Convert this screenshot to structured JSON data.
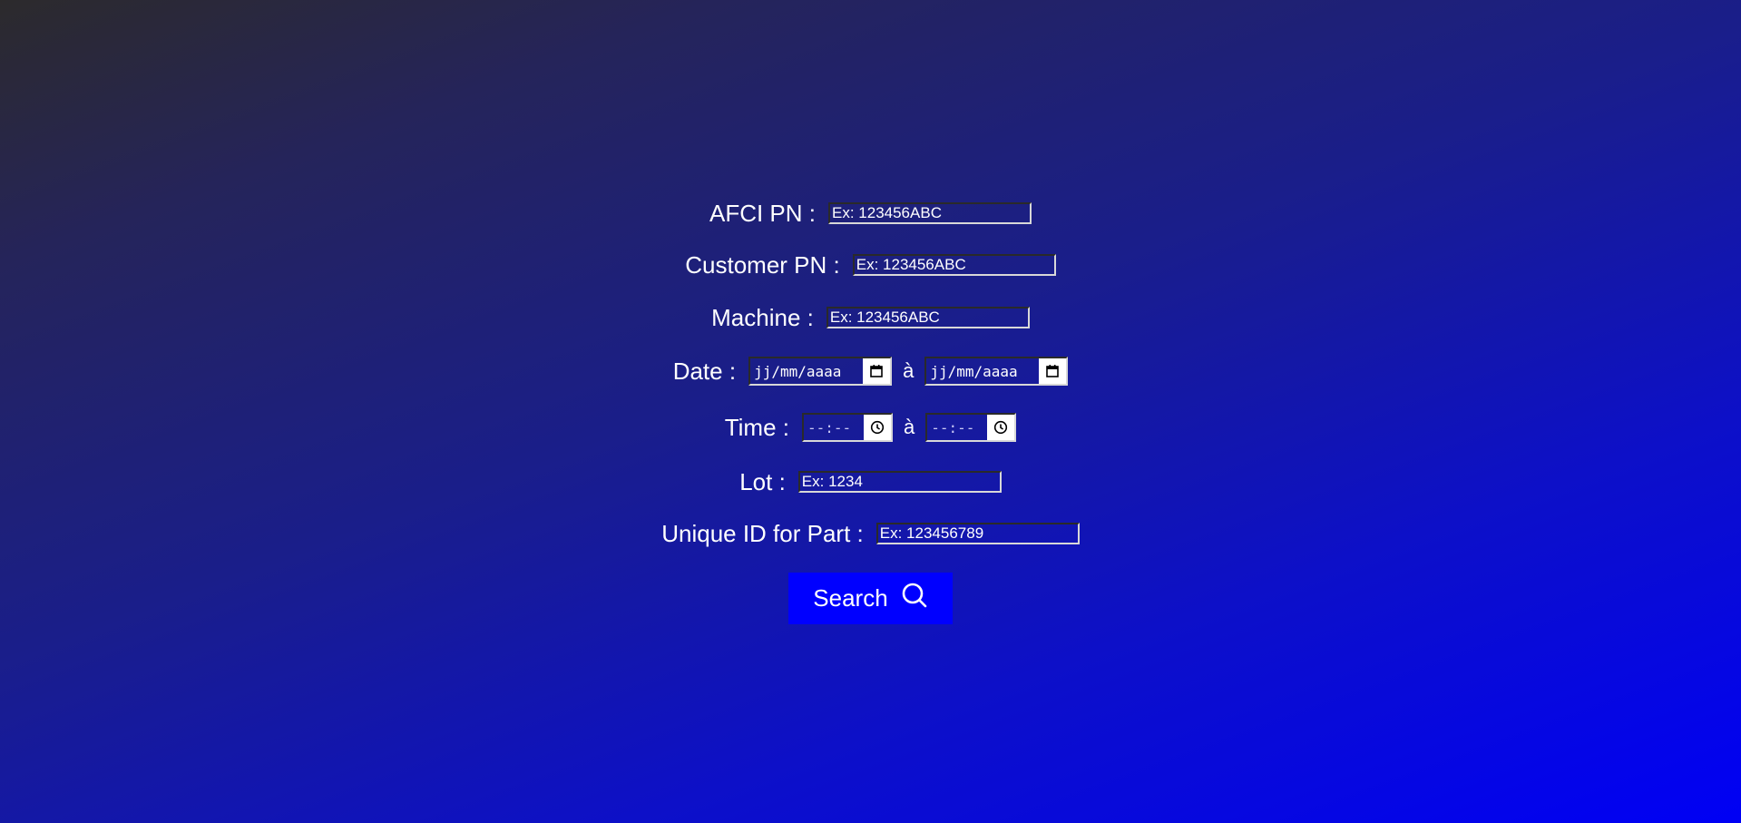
{
  "form": {
    "afci_pn": {
      "label": "AFCI PN :",
      "placeholder": "Ex: 123456ABC"
    },
    "customer_pn": {
      "label": "Customer PN :",
      "placeholder": "Ex: 123456ABC"
    },
    "machine": {
      "label": "Machine :",
      "placeholder": "Ex: 123456ABC"
    },
    "date": {
      "label": "Date :",
      "from_placeholder": "jj/mm/aaaa",
      "separator": "à",
      "to_placeholder": "jj/mm/aaaa"
    },
    "time": {
      "label": "Time :",
      "from_placeholder": "--:--",
      "separator": "à",
      "to_placeholder": "--:--"
    },
    "lot": {
      "label": "Lot :",
      "placeholder": "Ex: 1234"
    },
    "unique_id": {
      "label": "Unique ID for Part :",
      "placeholder": "Ex: 123456789"
    },
    "search_button": {
      "label": "Search",
      "icon": "search-icon"
    }
  },
  "colors": {
    "button": "#0000ff",
    "text": "#ffffff"
  }
}
